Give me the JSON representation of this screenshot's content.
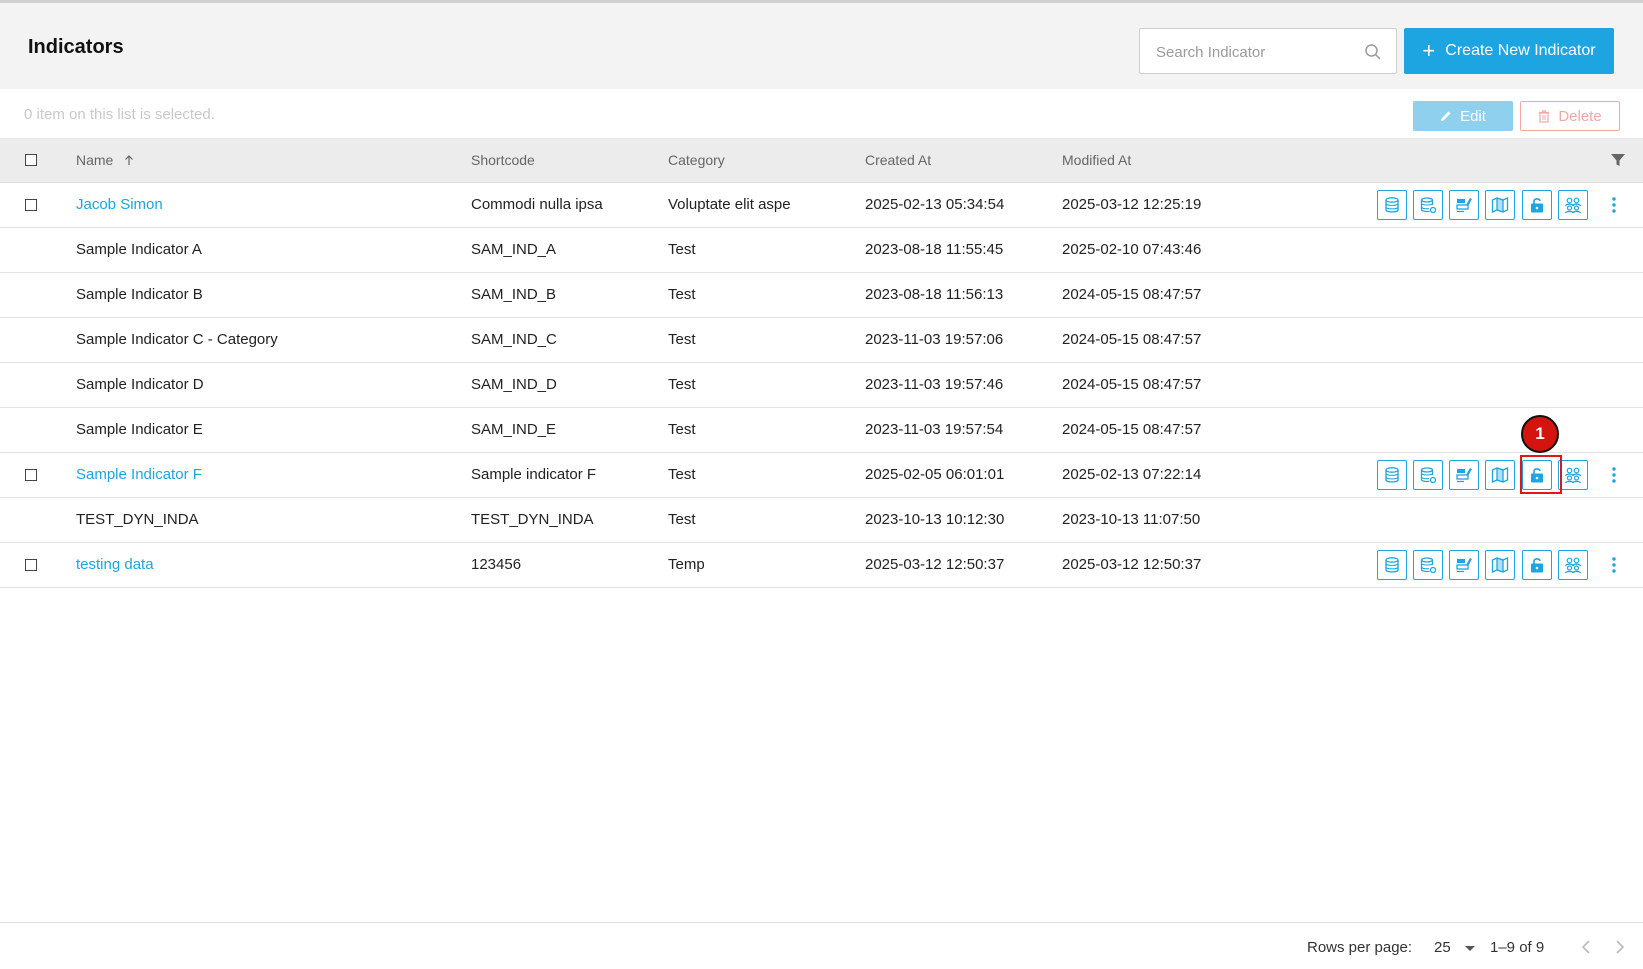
{
  "page": {
    "title": "Indicators"
  },
  "search": {
    "placeholder": "Search Indicator"
  },
  "create_button": {
    "label": "Create New Indicator"
  },
  "selection": {
    "text": "0 item on this list is selected.",
    "edit_label": "Edit",
    "delete_label": "Delete"
  },
  "columns": {
    "name": "Name",
    "shortcode": "Shortcode",
    "category": "Category",
    "created_at": "Created At",
    "modified_at": "Modified At"
  },
  "rows": [
    {
      "name": "Jacob Simon",
      "shortcode": "Commodi nulla ipsa",
      "category": "Voluptate elit aspe",
      "created_at": "2025-02-13 05:34:54",
      "modified_at": "2025-03-12 12:25:19",
      "link": true,
      "actions": true
    },
    {
      "name": "Sample Indicator A",
      "shortcode": "SAM_IND_A",
      "category": "Test",
      "created_at": "2023-08-18 11:55:45",
      "modified_at": "2025-02-10 07:43:46",
      "link": false,
      "actions": false
    },
    {
      "name": "Sample Indicator B",
      "shortcode": "SAM_IND_B",
      "category": "Test",
      "created_at": "2023-08-18 11:56:13",
      "modified_at": "2024-05-15 08:47:57",
      "link": false,
      "actions": false
    },
    {
      "name": "Sample Indicator C - Category",
      "shortcode": "SAM_IND_C",
      "category": "Test",
      "created_at": "2023-11-03 19:57:06",
      "modified_at": "2024-05-15 08:47:57",
      "link": false,
      "actions": false
    },
    {
      "name": "Sample Indicator D",
      "shortcode": "SAM_IND_D",
      "category": "Test",
      "created_at": "2023-11-03 19:57:46",
      "modified_at": "2024-05-15 08:47:57",
      "link": false,
      "actions": false
    },
    {
      "name": "Sample Indicator E",
      "shortcode": "SAM_IND_E",
      "category": "Test",
      "created_at": "2023-11-03 19:57:54",
      "modified_at": "2024-05-15 08:47:57",
      "link": false,
      "actions": false
    },
    {
      "name": "Sample Indicator F",
      "shortcode": "Sample indicator F",
      "category": "Test",
      "created_at": "2025-02-05 06:01:01",
      "modified_at": "2025-02-13 07:22:14",
      "link": true,
      "actions": true
    },
    {
      "name": "TEST_DYN_INDA",
      "shortcode": "TEST_DYN_INDA",
      "category": "Test",
      "created_at": "2023-10-13 10:12:30",
      "modified_at": "2023-10-13 11:07:50",
      "link": false,
      "actions": false
    },
    {
      "name": "testing data",
      "shortcode": "123456",
      "category": "Temp",
      "created_at": "2025-03-12 12:50:37",
      "modified_at": "2025-03-12 12:50:37",
      "link": true,
      "actions": true
    }
  ],
  "row_action_icons": [
    "database-icon",
    "database-settings-icon",
    "chart-edit-icon",
    "map-icon",
    "lock-open-icon",
    "users-icon"
  ],
  "annotation": {
    "marker": "1"
  },
  "pagination": {
    "rows_per_page_label": "Rows per page:",
    "rows_per_page": "25",
    "range": "1–9 of 9"
  },
  "colors": {
    "accent": "#1da5e1",
    "danger": "#f2a7a7",
    "marker": "#d4140f"
  }
}
